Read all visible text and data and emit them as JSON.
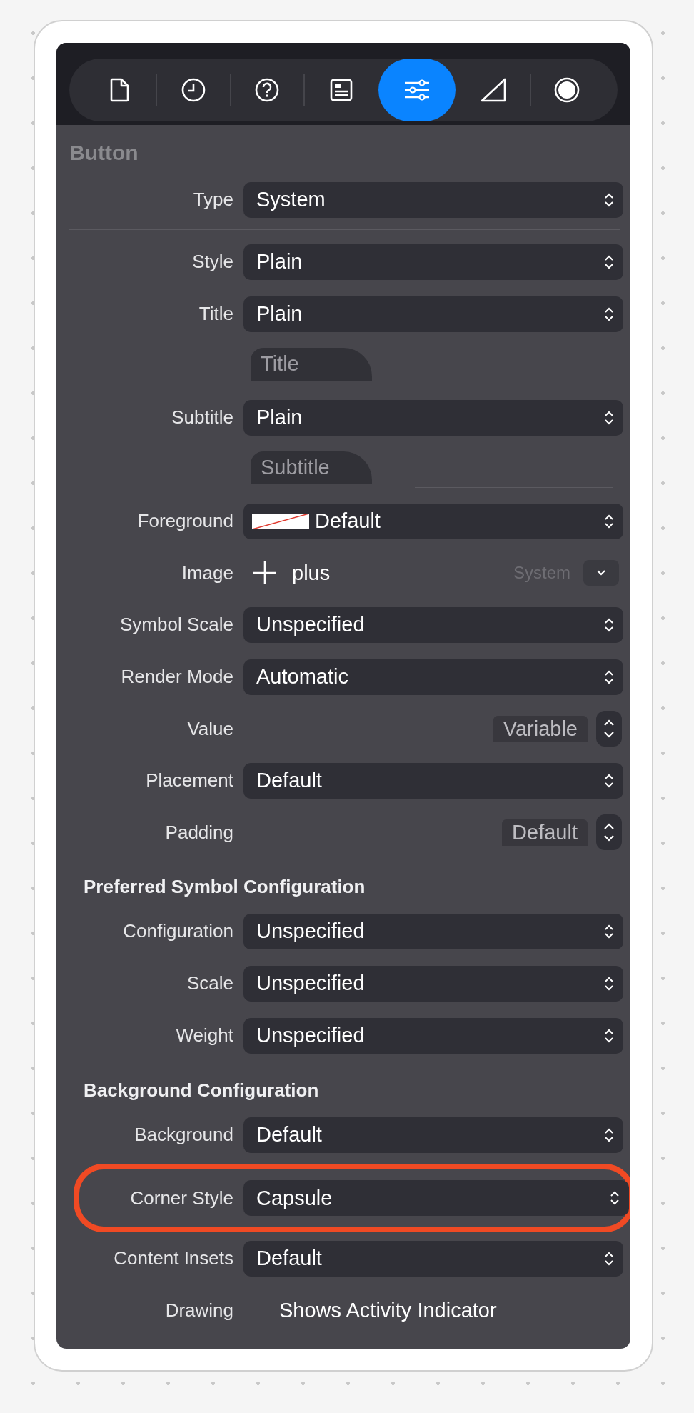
{
  "toolbar": {
    "tabs": [
      {
        "selected": false
      },
      {
        "selected": false
      },
      {
        "selected": false
      },
      {
        "selected": false
      },
      {
        "selected": true
      },
      {
        "selected": false
      },
      {
        "selected": false
      }
    ]
  },
  "section_title": "Button",
  "rows": [
    {
      "kind": "popup",
      "label": "Type",
      "value": "System"
    },
    {
      "kind": "popup",
      "label": "Style",
      "value": "Plain"
    },
    {
      "kind": "popup",
      "label": "Title",
      "value": "Plain"
    },
    {
      "kind": "textfield",
      "placeholder": "Title"
    },
    {
      "kind": "popup",
      "label": "Subtitle",
      "value": "Plain"
    },
    {
      "kind": "textfield",
      "placeholder": "Subtitle"
    },
    {
      "kind": "color",
      "label": "Foreground",
      "value": "Default"
    },
    {
      "kind": "image",
      "label": "Image",
      "value": "plus",
      "source": "System"
    },
    {
      "kind": "popup",
      "label": "Symbol Scale",
      "value": "Unspecified"
    },
    {
      "kind": "popup",
      "label": "Render Mode",
      "value": "Automatic"
    },
    {
      "kind": "stepper",
      "label": "Value",
      "value": "Variable"
    },
    {
      "kind": "popup",
      "label": "Placement",
      "value": "Default"
    },
    {
      "kind": "stepper",
      "label": "Padding",
      "value": "Default"
    },
    {
      "kind": "heading",
      "label": "Preferred Symbol Configuration"
    },
    {
      "kind": "popup",
      "label": "Configuration",
      "value": "Unspecified"
    },
    {
      "kind": "popup",
      "label": "Scale",
      "value": "Unspecified"
    },
    {
      "kind": "popup",
      "label": "Weight",
      "value": "Unspecified"
    },
    {
      "kind": "heading",
      "label": "Background Configuration"
    },
    {
      "kind": "popup",
      "label": "Background",
      "value": "Default"
    },
    {
      "kind": "popup",
      "label": "Corner Style",
      "value": "Capsule",
      "highlighted": true
    },
    {
      "kind": "popup",
      "label": "Content Insets",
      "value": "Default"
    },
    {
      "kind": "static",
      "label": "Drawing",
      "value": "Shows Activity Indicator"
    }
  ]
}
